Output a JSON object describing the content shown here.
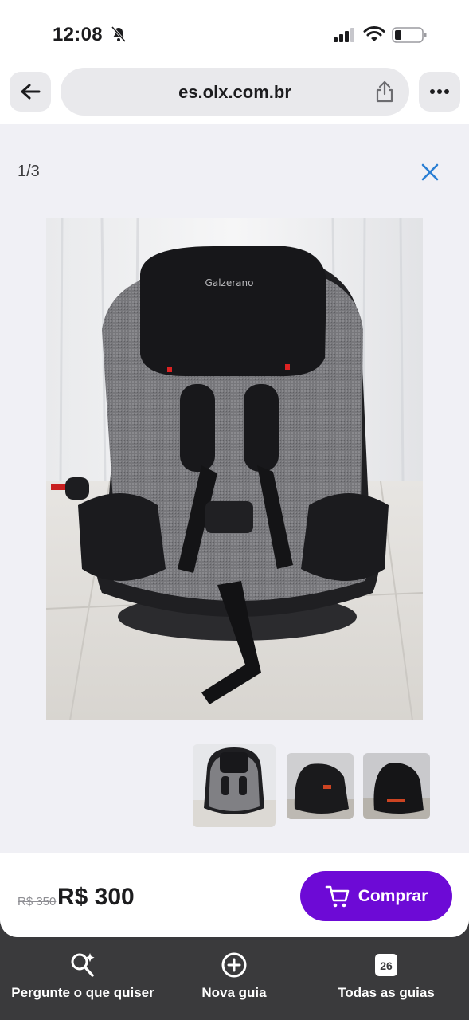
{
  "status_bar": {
    "time": "12:08"
  },
  "browser": {
    "url": "es.olx.com.br"
  },
  "gallery": {
    "counter": "1/3",
    "thumbnail_count": 3,
    "brand_label": "Galzerano"
  },
  "purchase": {
    "old_price": "R$ 350",
    "price": "R$ 300",
    "buy_label": "Comprar"
  },
  "toolbar": {
    "ask_label": "Pergunte o que quiser",
    "new_tab_label": "Nova guia",
    "all_tabs_label": "Todas as guias",
    "tab_count": "26"
  },
  "colors": {
    "accent": "#6d0ad6",
    "close_icon": "#2a7fd4",
    "toolbar_bg": "#3a3a3c"
  }
}
